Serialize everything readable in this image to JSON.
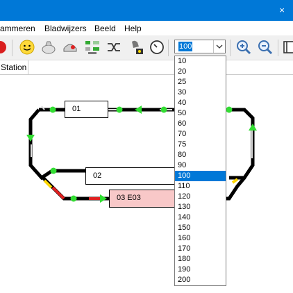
{
  "menu": [
    "ammeren",
    "Bladwijzers",
    "Beeld",
    "Help"
  ],
  "toolbar": {
    "icons": [
      "stop-icon",
      "smiley-icon",
      "loco-icon",
      "wagon-icon",
      "layout-icon",
      "shuffle-icon",
      "bell-icon",
      "clock-icon",
      "zoom-in-icon",
      "zoom-out-icon",
      "book-icon"
    ],
    "zoom_value": "100"
  },
  "tab_label": "Station",
  "blocks": {
    "b1": "01",
    "b2": "02",
    "b3": "03 E03"
  },
  "zoom_options": [
    "10",
    "20",
    "25",
    "30",
    "40",
    "50",
    "60",
    "70",
    "75",
    "80",
    "90",
    "100",
    "110",
    "120",
    "130",
    "140",
    "150",
    "160",
    "170",
    "180",
    "190",
    "200"
  ],
  "selected_zoom": "100",
  "colors": {
    "accent": "#0078d7",
    "occupied_block": "#f8c8c8",
    "signal_green": "#33dd33",
    "signal_red": "#e02020"
  },
  "close_glyph": "×"
}
